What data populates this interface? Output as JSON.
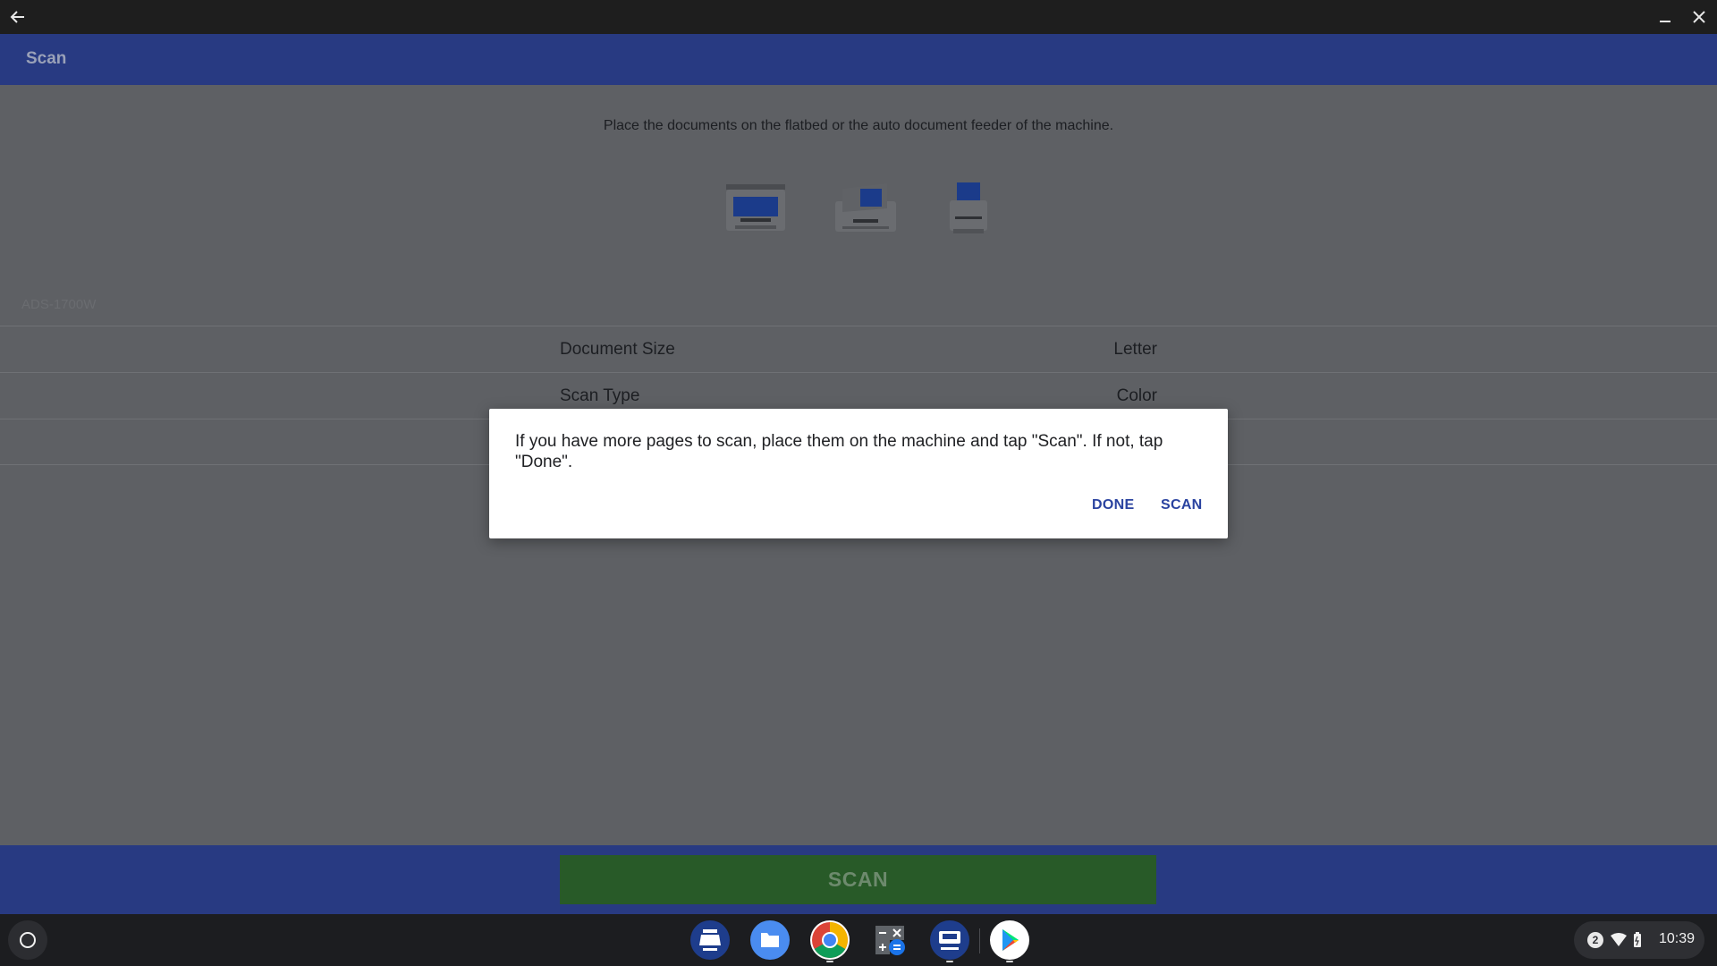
{
  "window": {
    "back_icon": "arrow-left-icon",
    "minimize_icon": "minimize-icon",
    "close_icon": "close-icon"
  },
  "appbar": {
    "title": "Scan"
  },
  "content": {
    "instruction": "Place the documents on the flatbed or the auto document feeder of the machine.",
    "scanner_icons": [
      "flatbed-scanner-icon",
      "adf-scanner-icon",
      "compact-scanner-icon"
    ],
    "model": "ADS-1700W",
    "settings": [
      {
        "label": "Document Size",
        "value": "Letter"
      },
      {
        "label": "Scan Type",
        "value": "Color"
      },
      {
        "label": "",
        "value": ""
      }
    ]
  },
  "dialog": {
    "message": "If you have more pages to scan, place them on the machine and tap \"Scan\". If not, tap \"Done\".",
    "done_label": "DONE",
    "scan_label": "SCAN"
  },
  "bottom": {
    "scan_label": "SCAN"
  },
  "shelf": {
    "apps": [
      "epson-app-icon",
      "files-app-icon",
      "chrome-app-icon",
      "calculator-app-icon",
      "brother-app-icon",
      "play-store-app-icon"
    ],
    "notification_count": "2",
    "time": "10:39"
  },
  "colors": {
    "appbar": "#283a82",
    "scan_button": "#285a28",
    "dialog_action": "#2a43a0",
    "overlay_bg": "#5e6064"
  }
}
